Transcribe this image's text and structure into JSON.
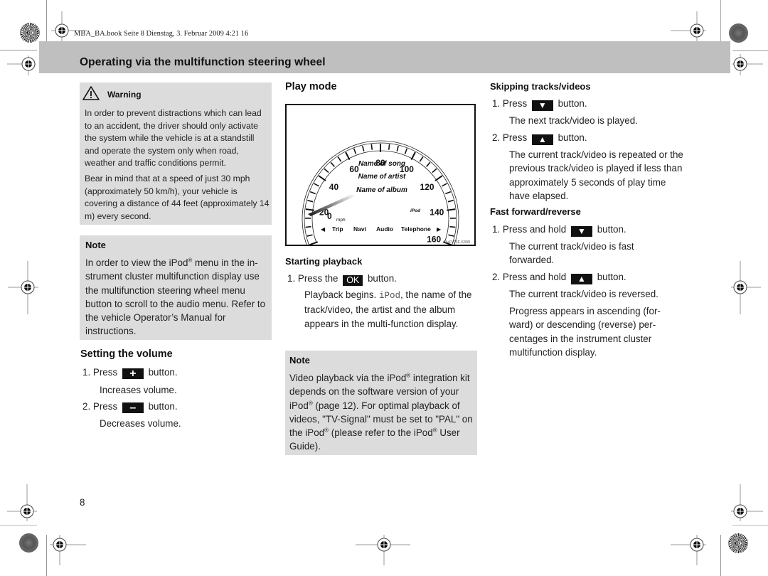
{
  "imprint": "MBA_BA.book  Seite 8  Dienstag, 3. Februar 2009  4:21 16",
  "header": {
    "title": "Operating via the multifunction steering wheel"
  },
  "warning": {
    "icon": "warning-triangle-icon",
    "title": "Warning",
    "paragraphs": [
      "In order to prevent distractions which can lead to an accident, the driver should only activate the system while the vehicle is at a standstill and operate the system only when road, weather and traffic conditions permit.",
      "Bear in mind that at a speed of just 30 mph (approximately 50 km/h), your vehicle is covering a distance of 44 feet (approximately 14 m) every second."
    ]
  },
  "note1": {
    "title": "Note",
    "text_before": "In order to view the iPod",
    "reg": "®",
    "text_after": " menu in the in­strument cluster multifunction display use the multifunction steering wheel menu button to scroll to the audio menu. Refer to the vehicle Operator’s Manual for instructions."
  },
  "volume": {
    "title": "Setting the volume",
    "steps": [
      {
        "num": "1.",
        "pre": "Press",
        "key": "+",
        "post": "button.",
        "result": "Increases volume."
      },
      {
        "num": "2.",
        "pre": "Press",
        "key": "–",
        "post": "button.",
        "result": "Decreases volume."
      }
    ]
  },
  "play_mode": {
    "title": "Play mode",
    "figure": {
      "speed_labels": [
        "20",
        "40",
        "60",
        "80",
        "100",
        "120",
        "140",
        "160"
      ],
      "unit": "mph",
      "zero": "0",
      "song": "Name of song",
      "artist": "Name of artist",
      "album": "Name of album",
      "source": "iPod",
      "menu": [
        "Trip",
        "Navi",
        "Audio",
        "Telephone"
      ],
      "ref": "M+P-03F-6390"
    }
  },
  "starting": {
    "title": "Starting playback",
    "step": {
      "num": "1.",
      "pre": "Press the",
      "key": "OK",
      "post": "button."
    },
    "result_pre": "Playback begins. ",
    "result_mono": "iPod",
    "result_post": ", the name of the track/video, the artist and the album appears in the multi-function display."
  },
  "note2": {
    "title": "Note",
    "segments": [
      "Video playback via the iPod",
      "®",
      " integration kit depends on the software version of your iPod",
      "®",
      " (page 12). For optimal play­back of videos, \"TV-Signal\" must be set to \"PAL\" on the iPod",
      "®",
      " (please refer to the iPod",
      "®",
      " User Guide)."
    ]
  },
  "skipping": {
    "title": "Skipping tracks/videos",
    "steps": [
      {
        "num": "1.",
        "pre": "Press",
        "key": "▼",
        "post": "button.",
        "result": "The next track/video is played."
      },
      {
        "num": "2.",
        "pre": "Press",
        "key": "▲",
        "post": "button.",
        "result": "The current track/video is repeated or the previous track/video is played if less than approximately 5 seconds of play time have elapsed."
      }
    ]
  },
  "fast": {
    "title": "Fast forward/reverse",
    "steps": [
      {
        "num": "1.",
        "pre": "Press and hold",
        "key": "▼",
        "post": "button.",
        "result": "The current track/video is fast forwarded."
      },
      {
        "num": "2.",
        "pre": "Press and hold",
        "key": "▲",
        "post": "button.",
        "result": "The current track/video is reversed."
      }
    ],
    "extra": "Progress appears in ascending (for­ward) or descending (reverse) per­centages in the instrument cluster multifunction display."
  },
  "page_number": "8"
}
